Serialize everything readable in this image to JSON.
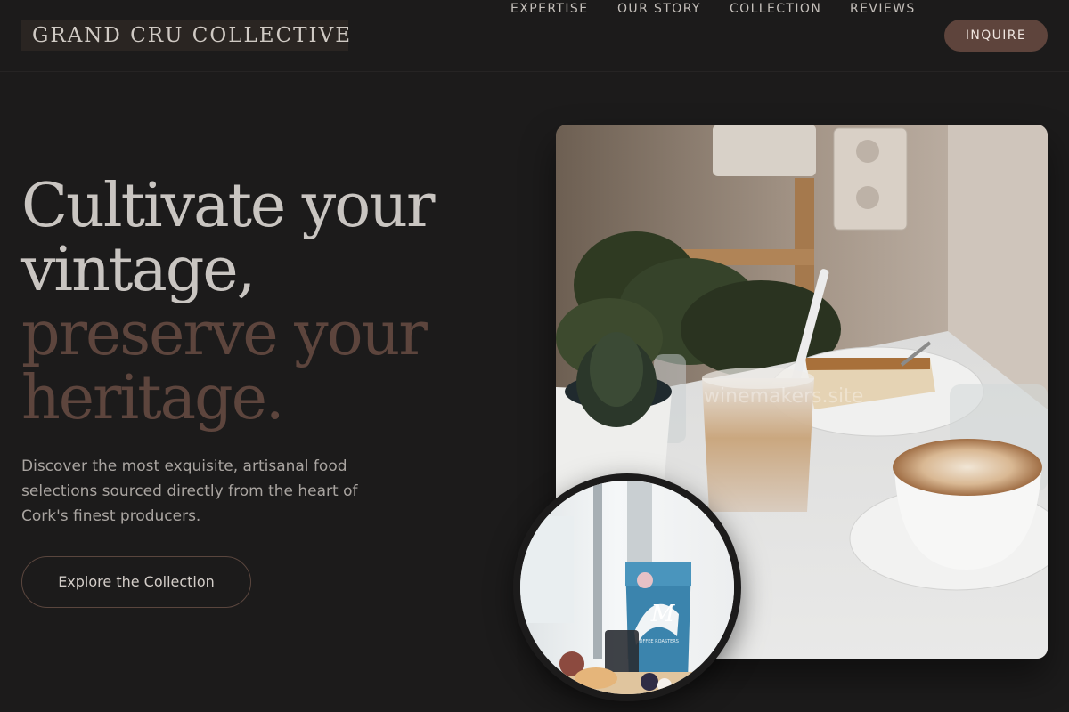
{
  "brand": {
    "logo_text": "GRAND CRU COLLECTIVE"
  },
  "nav": {
    "items": [
      {
        "label": "EXPERTISE"
      },
      {
        "label": "OUR STORY"
      },
      {
        "label": "COLLECTION"
      },
      {
        "label": "REVIEWS"
      }
    ],
    "cta_label": "INQUIRE"
  },
  "hero": {
    "headline_light": [
      "Cultivate your",
      "vintage,"
    ],
    "headline_accent": [
      "preserve your",
      "heritage."
    ],
    "intro": "Discover the most exquisite, artisanal food selections sourced directly from the heart of Cork's finest producers.",
    "cta_label": "Explore the Collection"
  },
  "images": {
    "main_watermark": "winemakers.site",
    "coffee_bag_label": "M",
    "coffee_bag_sub": "COFFEE ROASTERS"
  },
  "colors": {
    "background": "#1c1b1b",
    "accent": "#5e443c",
    "headline_accent": "#5d453d",
    "text_muted": "#a9a4a0"
  }
}
